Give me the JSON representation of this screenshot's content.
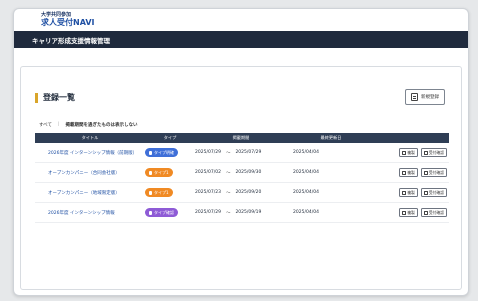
{
  "brand": {
    "subtitle": "大学共同参加",
    "name": "求人受付NAVI"
  },
  "nav": {
    "title": "キャリア形成支援情報管理"
  },
  "page": {
    "title": "登録一覧",
    "new_button": "新規登録"
  },
  "filters": {
    "all": "すべて",
    "hide_expired": "掲載期間を過ぎたものは表示しない"
  },
  "table": {
    "headers": [
      "タイトル",
      "タイプ",
      "掲載期間",
      "最終更新日"
    ],
    "rows": [
      {
        "title": "2026年度 インターンシップ情報（前期版）",
        "type": "タイプ明確",
        "type_color": "#3f6fd8",
        "start": "2025/07/29",
        "end": "2025/07/29",
        "updated": "2025/04/04",
        "action1": "複製",
        "action2": "受付確認"
      },
      {
        "title": "オープンカンパニー（合同会社版）",
        "type": "タイプ1",
        "type_color": "#f08a24",
        "start": "2025/07/02",
        "end": "2025/09/30",
        "updated": "2025/04/04",
        "action1": "複製",
        "action2": "受付確認"
      },
      {
        "title": "オープンカンパニー（地域限定版）",
        "type": "タイプ1",
        "type_color": "#f08a24",
        "start": "2025/07/23",
        "end": "2025/09/20",
        "updated": "2025/04/04",
        "action1": "複製",
        "action2": "受付確認"
      },
      {
        "title": "2026年度 インターンシップ情報",
        "type": "タイプ確認",
        "type_color": "#8e5bd6",
        "start": "2025/07/29",
        "end": "2025/09/19",
        "updated": "2025/04/04",
        "action1": "複製",
        "action2": "受付確認"
      }
    ],
    "period_separator": "〜"
  }
}
